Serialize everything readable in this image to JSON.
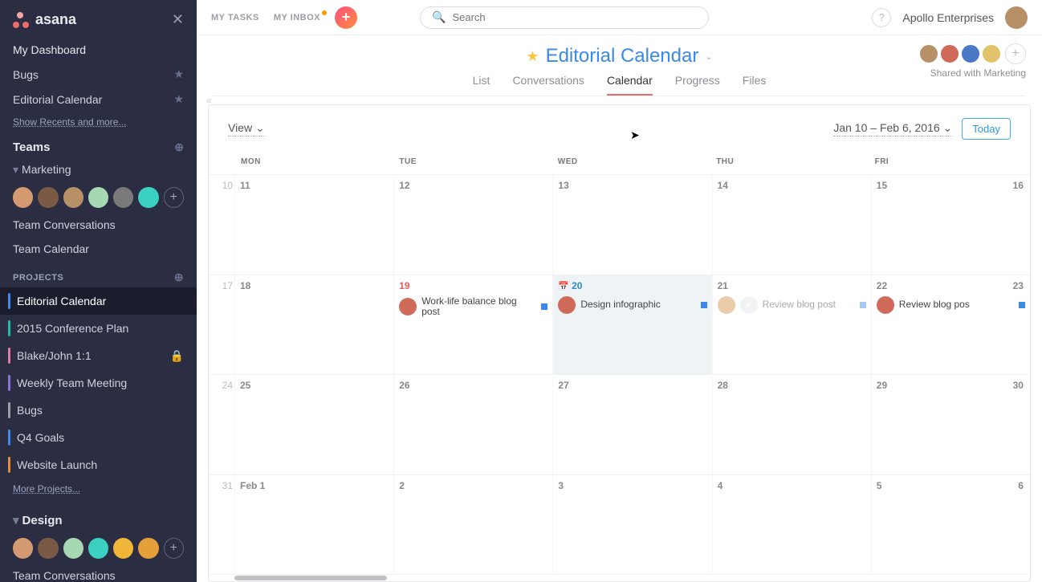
{
  "app": {
    "brand": "asana"
  },
  "sidebar": {
    "dashboard": "My Dashboard",
    "bugs": "Bugs",
    "editorial": "Editorial Calendar",
    "recents": "Show Recents and more...",
    "teams_label": "Teams",
    "marketing": {
      "name": "Marketing",
      "conversations": "Team Conversations",
      "calendar": "Team Calendar"
    },
    "projects_label": "PROJECTS",
    "projects": [
      {
        "name": "Editorial Calendar",
        "color": "#3b89e9",
        "active": true
      },
      {
        "name": "2015 Conference Plan",
        "color": "#1fbba6"
      },
      {
        "name": "Blake/John 1:1",
        "color": "#e07aa9",
        "locked": true
      },
      {
        "name": "Weekly Team Meeting",
        "color": "#8a72d6"
      },
      {
        "name": "Bugs",
        "color": "#9aa0a6"
      },
      {
        "name": "Q4 Goals",
        "color": "#3b89e9"
      },
      {
        "name": "Website Launch",
        "color": "#e28c3e"
      }
    ],
    "more_projects": "More Projects...",
    "design": {
      "name": "Design",
      "conversations": "Team Conversations"
    }
  },
  "topbar": {
    "my_tasks": "MY TASKS",
    "my_inbox": "MY INBOX",
    "search_placeholder": "Search",
    "org": "Apollo Enterprises"
  },
  "header": {
    "title": "Editorial Calendar",
    "tabs": {
      "list": "List",
      "conversations": "Conversations",
      "calendar": "Calendar",
      "progress": "Progress",
      "files": "Files"
    },
    "shared": "Shared with Marketing"
  },
  "calendar": {
    "view_label": "View",
    "date_range": "Jan 10 – Feb 6, 2016",
    "today": "Today",
    "day_names": [
      "MON",
      "TUE",
      "WED",
      "THU",
      "FRI"
    ],
    "weeks": [
      {
        "weeknum": "10",
        "days": [
          {
            "num": "11"
          },
          {
            "num": "12"
          },
          {
            "num": "13"
          },
          {
            "num": "14"
          },
          {
            "num": "15",
            "last": "16"
          }
        ]
      },
      {
        "weeknum": "17",
        "days": [
          {
            "num": "18"
          },
          {
            "num": "19",
            "red": true,
            "tasks": [
              {
                "av": "c7",
                "text": "Work-life balance blog post",
                "sq": true
              }
            ]
          },
          {
            "num": "20",
            "today": true,
            "icon": true,
            "tasks": [
              {
                "av": "c7",
                "text": "Design infographic",
                "sq": true
              }
            ]
          },
          {
            "num": "21",
            "tasks": [
              {
                "av": "c13",
                "check": true,
                "text": "Review blog post",
                "sq": true,
                "faded": true
              }
            ]
          },
          {
            "num": "22",
            "last": "23",
            "tasks": [
              {
                "av": "c7",
                "text": "Review blog pos",
                "sq": true
              }
            ]
          }
        ]
      },
      {
        "weeknum": "24",
        "days": [
          {
            "num": "25"
          },
          {
            "num": "26"
          },
          {
            "num": "27"
          },
          {
            "num": "28"
          },
          {
            "num": "29",
            "last": "30"
          }
        ]
      },
      {
        "weeknum": "31",
        "days": [
          {
            "num": "Feb 1"
          },
          {
            "num": "2"
          },
          {
            "num": "3"
          },
          {
            "num": "4"
          },
          {
            "num": "5",
            "last": "6"
          }
        ]
      }
    ]
  }
}
